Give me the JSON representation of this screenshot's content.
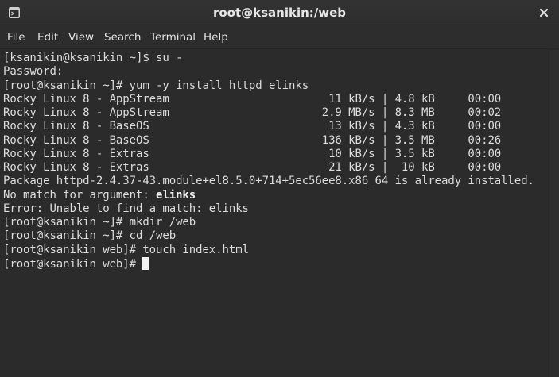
{
  "window": {
    "title": "root@ksanikin:/web"
  },
  "icons": {
    "window_icon": "terminal-icon",
    "close": "close-icon"
  },
  "menu": {
    "items": [
      "File",
      "Edit",
      "View",
      "Search",
      "Terminal",
      "Help"
    ]
  },
  "terminal": {
    "lines": [
      "[ksanikin@ksanikin ~]$ su -",
      "Password:",
      "[root@ksanikin ~]# yum -y install httpd elinks",
      "Rocky Linux 8 - AppStream                        11 kB/s | 4.8 kB     00:00",
      "Rocky Linux 8 - AppStream                       2.9 MB/s | 8.3 MB     00:02",
      "Rocky Linux 8 - BaseOS                           13 kB/s | 4.3 kB     00:00",
      "Rocky Linux 8 - BaseOS                          136 kB/s | 3.5 MB     00:26",
      "Rocky Linux 8 - Extras                           10 kB/s | 3.5 kB     00:00",
      "Rocky Linux 8 - Extras                           21 kB/s |  10 kB     00:00",
      "Package httpd-2.4.37-43.module+el8.5.0+714+5ec56ee8.x86_64 is already installed.",
      "No match for argument: ",
      "Error: Unable to find a match: elinks",
      "[root@ksanikin ~]# mkdir /web",
      "[root@ksanikin ~]# cd /web",
      "[root@ksanikin web]# touch index.html",
      "[root@ksanikin web]# "
    ],
    "bold_word": "elinks"
  },
  "colors": {
    "background": "#2b2b2b",
    "text": "#dcdcdc",
    "cursor": "#f2f2f2"
  }
}
